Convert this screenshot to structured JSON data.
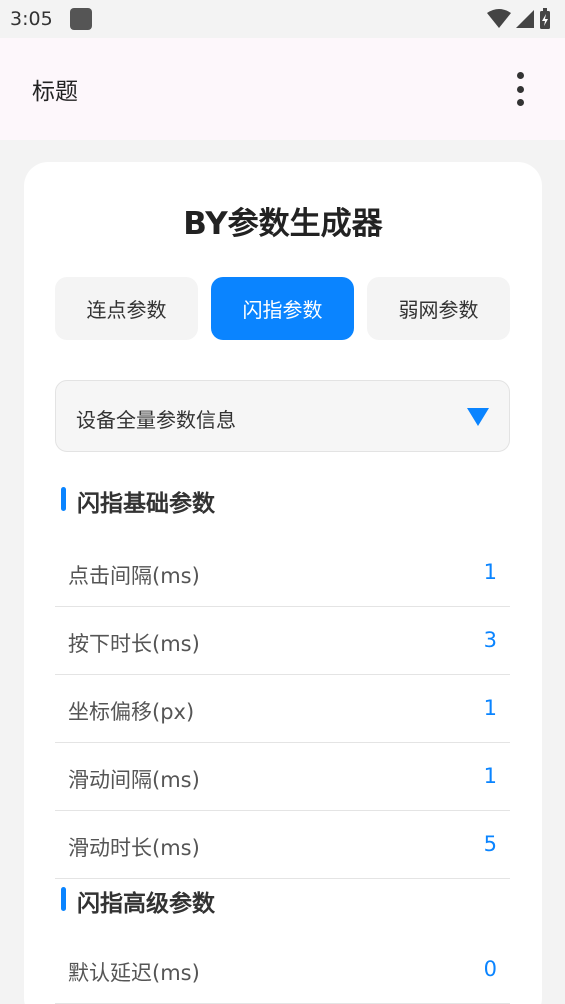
{
  "status_bar": {
    "time": "3:05"
  },
  "app_bar": {
    "title": "标题"
  },
  "card": {
    "title": "BY参数生成器"
  },
  "tabs": [
    {
      "label": "连点参数"
    },
    {
      "label": "闪指参数"
    },
    {
      "label": "弱网参数"
    }
  ],
  "dropdown": {
    "label": "设备全量参数信息"
  },
  "sections": [
    {
      "title": "闪指基础参数",
      "rows": [
        {
          "label": "点击间隔(ms)",
          "value": "1"
        },
        {
          "label": "按下时长(ms)",
          "value": "3"
        },
        {
          "label": "坐标偏移(px)",
          "value": "1"
        },
        {
          "label": "滑动间隔(ms)",
          "value": "1"
        },
        {
          "label": "滑动时长(ms)",
          "value": "5"
        }
      ]
    },
    {
      "title": "闪指高级参数",
      "rows": [
        {
          "label": "默认延迟(ms)",
          "value": "0"
        }
      ]
    }
  ],
  "colors": {
    "accent": "#0a84ff",
    "app_bar_bg": "#fdf7fb",
    "page_bg": "#f3f3f3"
  }
}
